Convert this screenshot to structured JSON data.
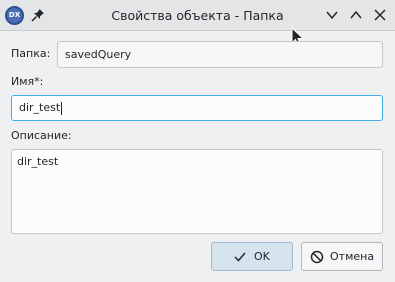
{
  "window": {
    "title": "Свойства объекта - Папка",
    "app_icon_text": "DX"
  },
  "form": {
    "folder_label": "Папка:",
    "folder_value": "savedQuery",
    "name_label": "Имя*:",
    "name_value": "dir_test",
    "description_label": "Описание:",
    "description_value": "dir_test"
  },
  "buttons": {
    "ok_label": "OK",
    "cancel_label": "Отмена"
  },
  "colors": {
    "accent": "#3daee9",
    "ok_button_bg": "#d6e4ee"
  }
}
